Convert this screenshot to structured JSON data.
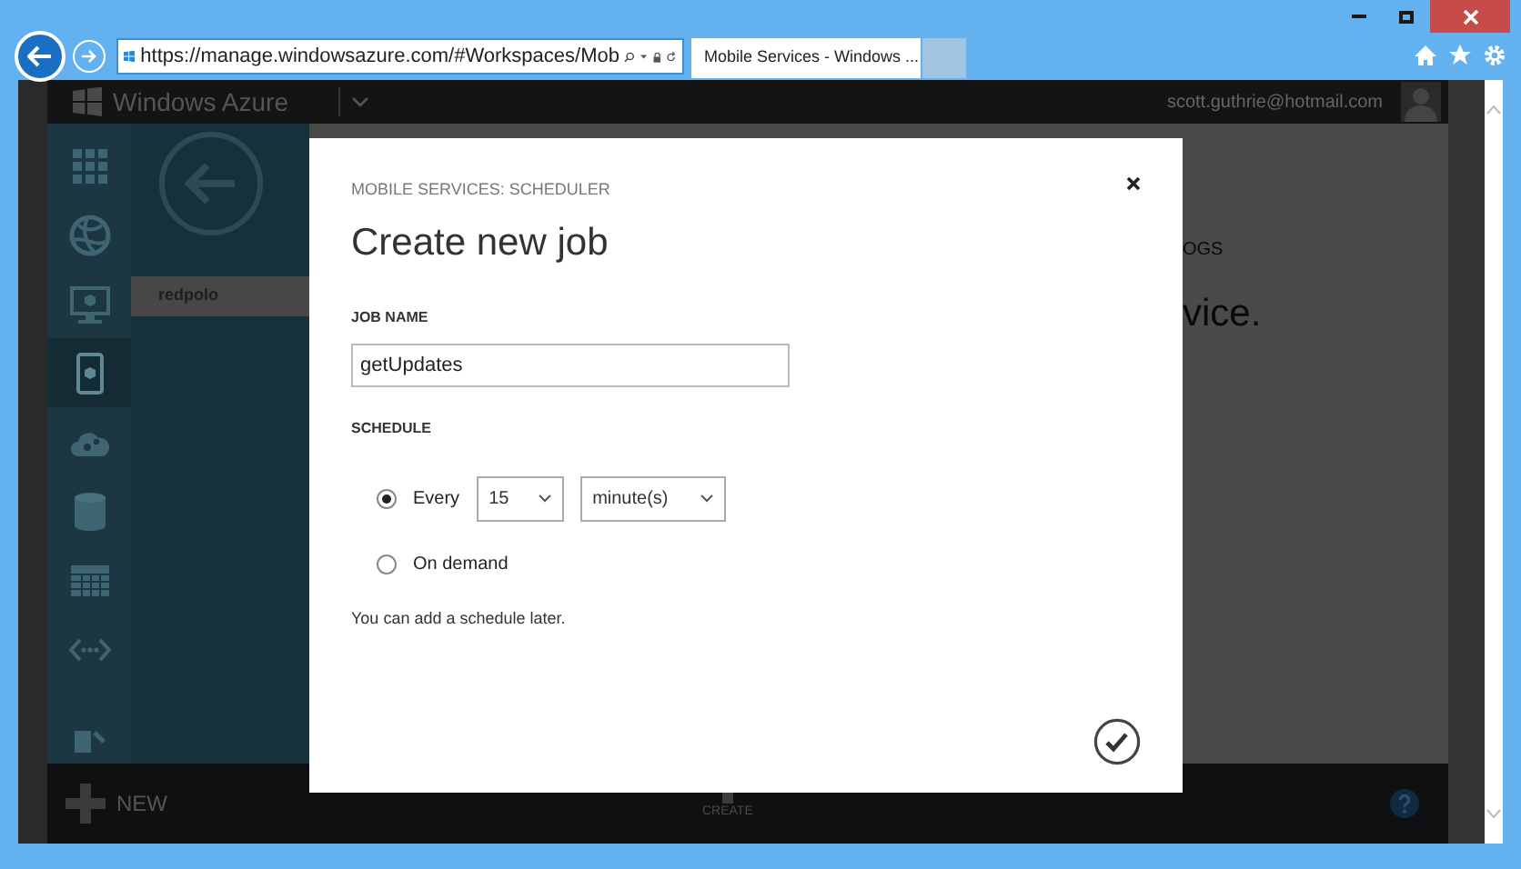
{
  "browser": {
    "address": "https://manage.windowsazure.com/#Workspaces/Mob",
    "tab_title": "Mobile Services - Windows ..."
  },
  "portal": {
    "brand": "Windows Azure",
    "user": "scott.guthrie@hotmail.com",
    "nav_items": [
      {
        "kind": "grid",
        "selected": false
      },
      {
        "kind": "globe",
        "selected": false
      },
      {
        "kind": "monitor",
        "selected": false
      },
      {
        "kind": "mobile",
        "selected": true
      },
      {
        "kind": "cloud",
        "selected": false
      },
      {
        "kind": "db",
        "selected": false
      },
      {
        "kind": "table",
        "selected": false
      },
      {
        "kind": "code",
        "selected": false
      },
      {
        "kind": "export",
        "selected": false
      }
    ],
    "list_items": [
      {
        "label": "redpolo",
        "selected": true
      }
    ],
    "section_label": "OGS",
    "headline": "vice.",
    "new_button": "NEW",
    "create_button": "CREATE"
  },
  "dialog": {
    "eyebrow": "MOBILE SERVICES: SCHEDULER",
    "title": "Create new job",
    "job_name_label": "JOB NAME",
    "job_name": "getUpdates",
    "schedule_label": "SCHEDULE",
    "options": [
      {
        "kind": "interval",
        "label": "Every",
        "selected": true,
        "count": "15",
        "unit": "minute(s)"
      },
      {
        "kind": "plain",
        "label": "On demand",
        "selected": false
      }
    ],
    "note": "You can add a schedule later."
  }
}
